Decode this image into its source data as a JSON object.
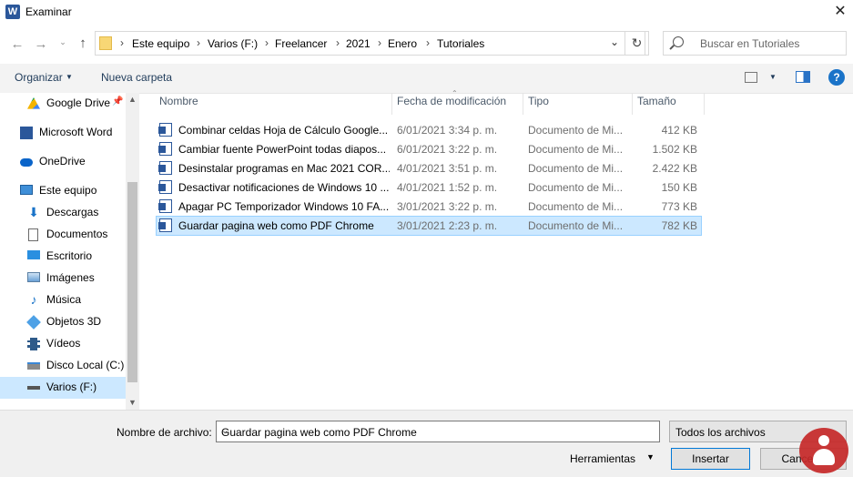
{
  "window": {
    "title": "Examinar",
    "app_icon": "W"
  },
  "nav": {
    "breadcrumb": [
      "Este equipo",
      "Varios (F:)",
      "Freelancer",
      "2021",
      "Enero",
      "Tutoriales"
    ],
    "search_placeholder": "Buscar en Tutoriales"
  },
  "toolbar": {
    "organize": "Organizar",
    "new_folder": "Nueva carpeta"
  },
  "sidebar": {
    "items": [
      {
        "label": "Google Drive"
      },
      {
        "label": "Microsoft Word"
      },
      {
        "label": "OneDrive"
      },
      {
        "label": "Este equipo"
      },
      {
        "label": "Descargas"
      },
      {
        "label": "Documentos"
      },
      {
        "label": "Escritorio"
      },
      {
        "label": "Imágenes"
      },
      {
        "label": "Música"
      },
      {
        "label": "Objetos 3D"
      },
      {
        "label": "Vídeos"
      },
      {
        "label": "Disco Local (C:)"
      },
      {
        "label": "Varios (F:)"
      }
    ]
  },
  "columns": {
    "name": "Nombre",
    "modified": "Fecha de modificación",
    "type": "Tipo",
    "size": "Tamaño"
  },
  "files": [
    {
      "name": "Combinar celdas Hoja de Cálculo Google...",
      "modified": "6/01/2021 3:34 p. m.",
      "type": "Documento de Mi...",
      "size": "412 KB"
    },
    {
      "name": "Cambiar fuente PowerPoint todas diapos...",
      "modified": "6/01/2021 3:22 p. m.",
      "type": "Documento de Mi...",
      "size": "1.502 KB"
    },
    {
      "name": "Desinstalar programas en Mac 2021  COR...",
      "modified": "4/01/2021 3:51 p. m.",
      "type": "Documento de Mi...",
      "size": "2.422 KB"
    },
    {
      "name": "Desactivar notificaciones de Windows 10 ...",
      "modified": "4/01/2021 1:52 p. m.",
      "type": "Documento de Mi...",
      "size": "150 KB"
    },
    {
      "name": "Apagar PC Temporizador Windows 10  FA...",
      "modified": "3/01/2021 3:22 p. m.",
      "type": "Documento de Mi...",
      "size": "773 KB"
    },
    {
      "name": "Guardar pagina web como PDF Chrome",
      "modified": "3/01/2021 2:23 p. m.",
      "type": "Documento de Mi...",
      "size": "782 KB"
    }
  ],
  "footer": {
    "filename_label": "Nombre de archivo:",
    "filename_value": "Guardar pagina web como PDF Chrome",
    "filter": "Todos los archivos",
    "tools": "Herramientas",
    "insert": "Insertar",
    "cancel": "Cancelar"
  },
  "colors": {
    "selection": "#cce8ff",
    "accent": "#0078d7",
    "word_blue": "#2b579a"
  }
}
